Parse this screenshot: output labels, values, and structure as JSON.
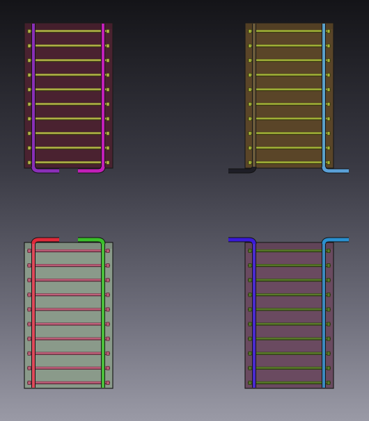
{
  "scene": {
    "background_top": "#141418",
    "background_bottom": "#9a9aa6"
  },
  "panels": [
    {
      "id": "panel-top-left",
      "pipe_position": "bottom",
      "rows": 10,
      "fill": "#4a2230",
      "left_pipe_color": "#8a2fb8",
      "right_pipe_color": "#c21fb8",
      "rung_color": "#b8b84a",
      "rung_edge_color": "#3a3a12",
      "left_stub_color": "#8a2fb8",
      "right_stub_color": "#c21fb8",
      "left_stub_extends_out": false,
      "right_stub_extends_out": false
    },
    {
      "id": "panel-top-right",
      "pipe_position": "bottom",
      "rows": 10,
      "fill": "#5a4528",
      "left_pipe_color": "#6a5a3a",
      "right_pipe_color": "#5aa0c8",
      "rung_color": "#a8b83a",
      "rung_edge_color": "#3a3a10",
      "left_stub_color": "#1e1e26",
      "right_stub_color": "#5aa0d8",
      "left_stub_extends_out": true,
      "right_stub_extends_out": true
    },
    {
      "id": "panel-bottom-left",
      "pipe_position": "top",
      "rows": 10,
      "fill": "#8a9a8a",
      "left_pipe_color": "#e04a5a",
      "right_pipe_color": "#4ac03a",
      "rung_color": "#c0607a",
      "rung_edge_color": "#5a2a38",
      "left_stub_color": "#e02a3a",
      "right_stub_color": "#3ac02a",
      "left_stub_extends_out": false,
      "right_stub_extends_out": false
    },
    {
      "id": "panel-bottom-right",
      "pipe_position": "top",
      "rows": 10,
      "fill": "#6a4a60",
      "left_pipe_color": "#4a2ad0",
      "right_pipe_color": "#3a8ac0",
      "rung_color": "#5a7a2a",
      "rung_edge_color": "#2a3a10",
      "left_stub_color": "#3a1ad8",
      "right_stub_color": "#2a90d0",
      "left_stub_extends_out": true,
      "right_stub_extends_out": true
    }
  ]
}
